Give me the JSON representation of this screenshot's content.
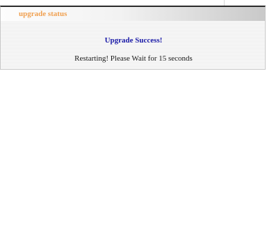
{
  "panel": {
    "title": "upgrade status"
  },
  "status": {
    "success_message": "Upgrade Success!",
    "restart_message": "Restarting! Please Wait for 15 seconds"
  },
  "colors": {
    "title": "#f0a050",
    "success": "#1a1aa8",
    "body_text": "#1a1a1a",
    "header_border": "#2b2b2b"
  }
}
